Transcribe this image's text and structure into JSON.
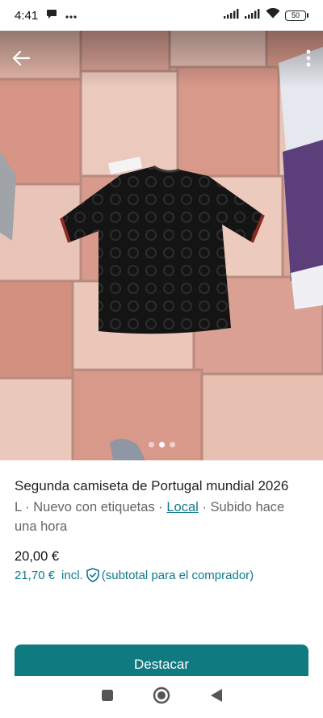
{
  "status_bar": {
    "time": "4:41",
    "battery": "50",
    "icons": [
      "chat-notification-icon",
      "more-notifications-icon",
      "signal-icon",
      "signal-icon",
      "wifi-icon",
      "battery-icon"
    ]
  },
  "photo": {
    "description_icons": [
      "back-arrow-icon",
      "more-vertical-icon"
    ],
    "dots_total": 3,
    "dots_active_index": 1
  },
  "listing": {
    "title": "Segunda camiseta de Portugal mundial 2026",
    "size": "L",
    "separator": " · ",
    "condition": "Nuevo con etiquetas",
    "location_link": "Local",
    "uploaded": "Subido hace una hora",
    "price": "20,00 €",
    "buyer_price": "21,70 €",
    "buyer_price_incl": "incl.",
    "buyer_price_note": "(subtotal para el comprador)"
  },
  "actions": {
    "feature_button": "Destacar"
  },
  "colors": {
    "accent": "#0f7a80",
    "link": "#0f7a8c"
  }
}
